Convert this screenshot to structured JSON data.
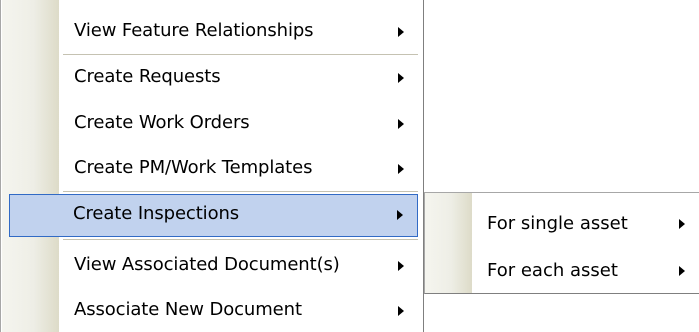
{
  "context_menu": {
    "items": [
      {
        "label": "View Feature Relationships",
        "submenu_arrow": "chevron-right-icon"
      },
      {
        "label": "Create Requests",
        "submenu_arrow": "chevron-right-icon"
      },
      {
        "label": "Create Work Orders",
        "submenu_arrow": "chevron-right-icon"
      },
      {
        "label": "Create PM/Work Templates",
        "submenu_arrow": "chevron-right-icon"
      },
      {
        "label": "Create Inspections",
        "submenu_arrow": "chevron-right-icon",
        "highlighted": true
      },
      {
        "label": "View Associated Document(s)",
        "submenu_arrow": "chevron-right-icon"
      },
      {
        "label": "Associate New Document",
        "submenu_arrow": "chevron-right-icon"
      }
    ]
  },
  "submenu": {
    "items": [
      {
        "label": "For single asset",
        "submenu_arrow": "chevron-right-icon"
      },
      {
        "label": "For each asset",
        "submenu_arrow": "chevron-right-icon"
      }
    ]
  },
  "colors": {
    "highlight_fill": "#c1d2ee",
    "highlight_border": "#316ac5",
    "gutter": "#eeeee6",
    "separator": "#c5c2b2"
  }
}
